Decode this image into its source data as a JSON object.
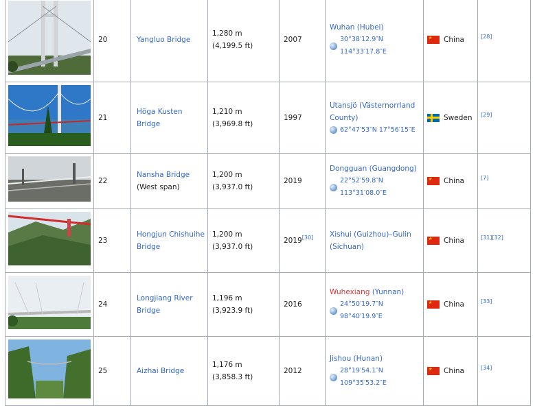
{
  "rows": [
    {
      "rank": "20",
      "name": "Yangluo Bridge",
      "name2": "",
      "len_m": "1,280 m",
      "len_ft": "(4,199.5 ft)",
      "year": "2007",
      "year_ref": "",
      "loc_main": "Wuhan",
      "loc_paren": " (Hubei)",
      "loc_red": false,
      "coord": "30°38′12.9″N 114°33′17.8″E",
      "country": "China",
      "flag": "cn",
      "ref": "[28]"
    },
    {
      "rank": "21",
      "name": "Höga Kusten",
      "name2": "Bridge",
      "len_m": "1,210 m",
      "len_ft": "(3,969.8 ft)",
      "year": "1997",
      "year_ref": "",
      "loc_main": "Utansjö",
      "loc_paren": " (Västernorrland County)",
      "loc_red": false,
      "coord": "62°47′53″N 17°56′15″E",
      "country": "Sweden",
      "flag": "se",
      "ref": "[29]"
    },
    {
      "rank": "22",
      "name": "Nansha Bridge",
      "name2": "(West span)",
      "len_m": "1,200 m",
      "len_ft": "(3,937.0 ft)",
      "year": "2019",
      "year_ref": "",
      "loc_main": "Dongguan",
      "loc_paren": " (Guangdong)",
      "loc_red": false,
      "coord": "22°52′59.8″N 113°31′08.0″E",
      "country": "China",
      "flag": "cn",
      "ref": "[7]"
    },
    {
      "rank": "23",
      "name": "Hongjun Chishuihe",
      "name2": "Bridge",
      "len_m": "1,200 m",
      "len_ft": "(3,937.0 ft)",
      "year": "2019",
      "year_ref": "[30]",
      "loc_main": "Xishui",
      "loc_paren": " (Guizhou)–Gulin (Sichuan)",
      "loc_red": false,
      "coord": "",
      "country": "China",
      "flag": "cn",
      "ref": "[31][32]"
    },
    {
      "rank": "24",
      "name": "Longjiang River",
      "name2": "Bridge",
      "len_m": "1,196 m",
      "len_ft": "(3,923.9 ft)",
      "year": "2016",
      "year_ref": "",
      "loc_main": "Wuhexiang",
      "loc_paren": " (Yunnan)",
      "loc_red": true,
      "coord": "24°50′19.7″N 98°40′19.9″E",
      "country": "China",
      "flag": "cn",
      "ref": "[33]"
    },
    {
      "rank": "25",
      "name": "Aizhai Bridge",
      "name2": "",
      "len_m": "1,176 m",
      "len_ft": "(3,858.3 ft)",
      "year": "2012",
      "year_ref": "",
      "loc_main": "Jishou",
      "loc_paren": " (Hunan)",
      "loc_red": false,
      "coord": "28°19′54.1″N 109°35′53.2″E",
      "country": "China",
      "flag": "cn",
      "ref": "[34]"
    }
  ]
}
